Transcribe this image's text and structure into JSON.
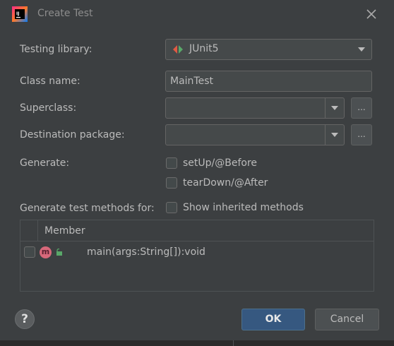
{
  "dialog": {
    "title": "Create Test",
    "app_icon": "intellij-idea-icon",
    "close_icon": "close-icon"
  },
  "form": {
    "testing_library_label": "Testing library:",
    "testing_library_value": "JUnit5",
    "class_name_label": "Class name:",
    "class_name_value": "MainTest",
    "superclass_label": "Superclass:",
    "superclass_value": "",
    "superclass_browse": "...",
    "destination_label": "Destination package:",
    "destination_value": "",
    "destination_browse": "...",
    "generate_label": "Generate:",
    "generate_options": [
      {
        "label": "setUp/@Before",
        "checked": false
      },
      {
        "label": "tearDown/@After",
        "checked": false
      }
    ],
    "generate_methods_label": "Generate test methods for:",
    "show_inherited_label": "Show inherited methods",
    "show_inherited_checked": false
  },
  "member_table": {
    "header": "Member",
    "rows": [
      {
        "checked": false,
        "icon": "method-icon",
        "visibility_icon": "public-lock-icon",
        "method_badge": "m",
        "text": "main(args:String[]):void"
      }
    ]
  },
  "buttons": {
    "help": "?",
    "ok": "OK",
    "cancel": "Cancel"
  },
  "colors": {
    "background": "#3c3f41",
    "primary_button": "#365880",
    "method_icon": "#d7687a",
    "junit_red": "#e05a43",
    "junit_green": "#59a869"
  }
}
